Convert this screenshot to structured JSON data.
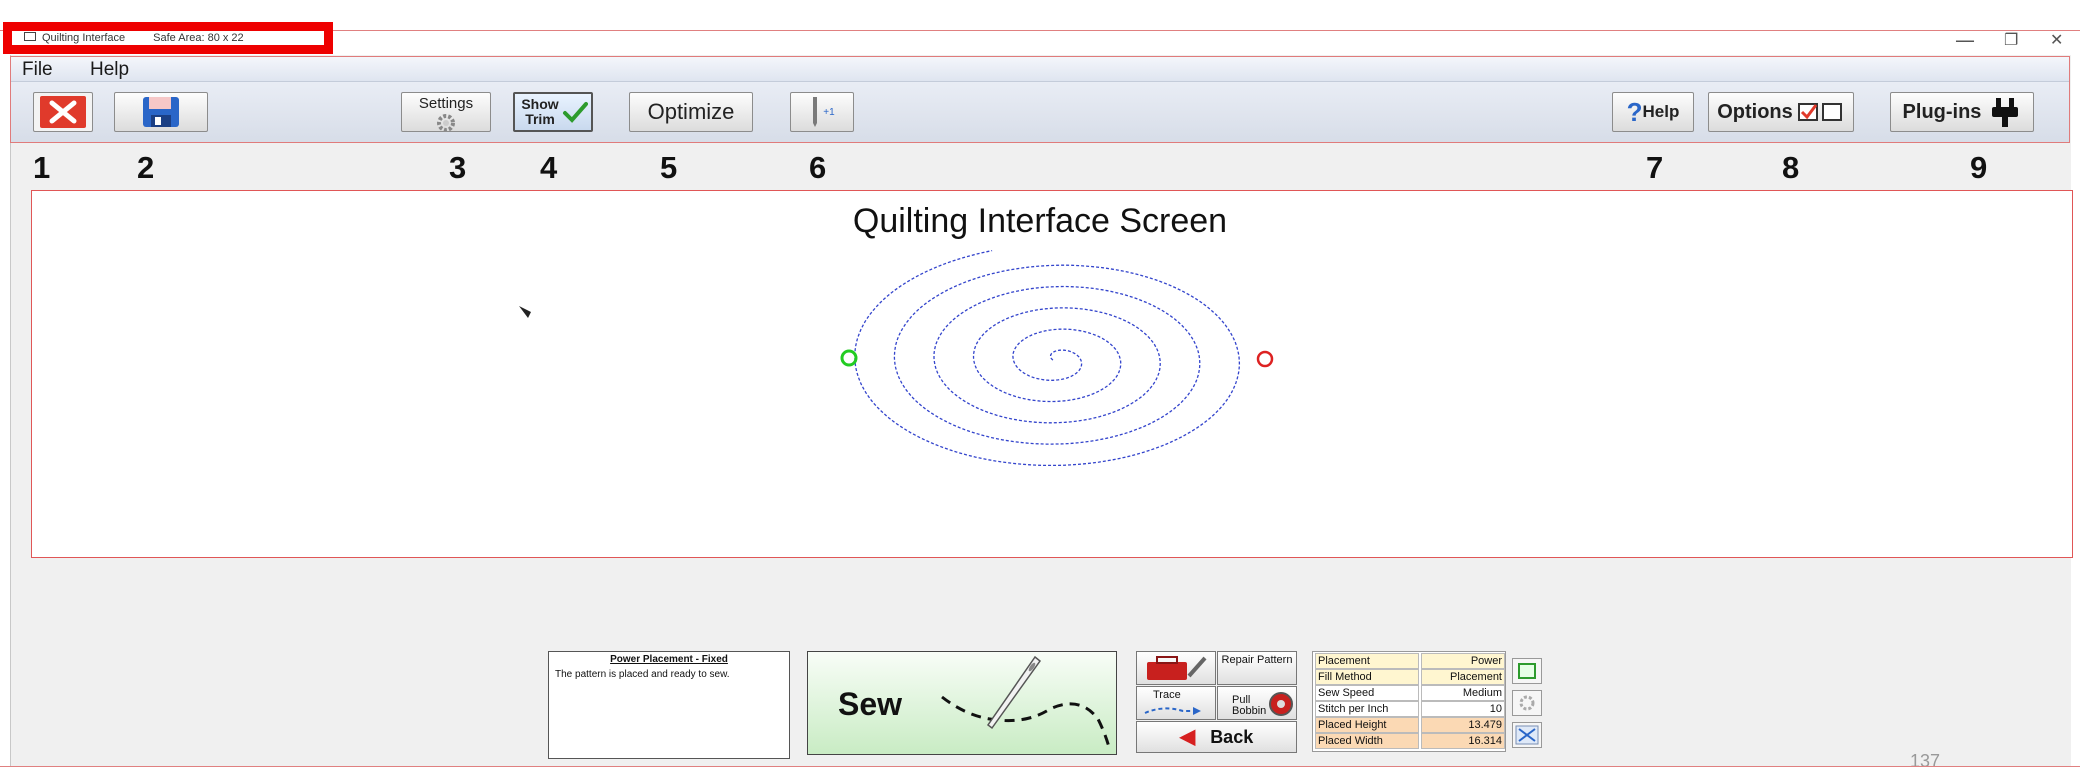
{
  "window": {
    "title": "Quilting Interface",
    "safe_area": "Safe Area:  80 x 22",
    "controls": [
      "—",
      "❐",
      "✕"
    ]
  },
  "menu": [
    "File",
    "Help"
  ],
  "toolbar": {
    "close_icon": "close-x-icon",
    "save_icon": "floppy-disk-icon",
    "settings_label": "Settings",
    "show_trim_label": "Show Trim",
    "optimize_label": "Optimize",
    "needle_label": "+1",
    "help_label": "Help",
    "options_label": "Options",
    "plugins_label": "Plug-ins",
    "accent_red": "#e03a2b",
    "accent_blue": "#2a66c8",
    "accent_green": "#2d9b2d"
  },
  "callouts": [
    "1",
    "2",
    "3",
    "4",
    "5",
    "6",
    "7",
    "8",
    "9"
  ],
  "canvas": {
    "title": "Quilting Interface Screen",
    "start_marker_color": "#22cc22",
    "end_marker_color": "#dd2222",
    "pattern_color": "#3344cc"
  },
  "status": {
    "title": "Power Placement - Fixed",
    "text": "The pattern is placed and ready to sew."
  },
  "sew_label": "Sew",
  "actions": {
    "repair_label": "Repair Pattern",
    "trace_label": "Trace",
    "pull_bobbin_label": "Pull Bobbin",
    "back_label": "Back"
  },
  "params": [
    {
      "name": "Placement",
      "value": "Power"
    },
    {
      "name": "Fill Method",
      "value": "Placement"
    },
    {
      "name": "Sew Speed",
      "value": "Medium"
    },
    {
      "name": "Stitch per Inch",
      "value": "10"
    },
    {
      "name": "Placed Height",
      "value": "13.479"
    },
    {
      "name": "Placed Width",
      "value": "16.314"
    }
  ],
  "page_number": "137"
}
